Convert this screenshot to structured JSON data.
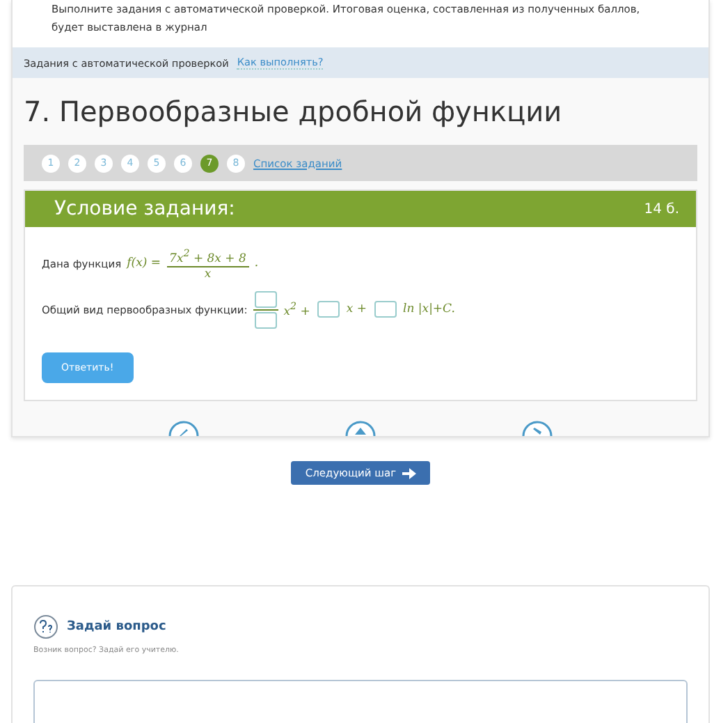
{
  "intro": {
    "text": "Выполните задания с автоматической проверкой. Итоговая оценка, составленная из полученных баллов, будет выставлена в журнал"
  },
  "section_bar": {
    "label": "Задания с автоматической проверкой",
    "link": "Как выполнять?"
  },
  "title": "7. Первообразные дробной функции",
  "pagination": {
    "pages": [
      {
        "label": "1",
        "selected": false
      },
      {
        "label": "2",
        "selected": false
      },
      {
        "label": "3",
        "selected": false
      },
      {
        "label": "4",
        "selected": false
      },
      {
        "label": "5",
        "selected": false
      },
      {
        "label": "6",
        "selected": false
      },
      {
        "label": "7",
        "selected": true
      },
      {
        "label": "8",
        "selected": false
      }
    ],
    "list_link": "Список заданий"
  },
  "task": {
    "header": "Условие задания:",
    "points": "14 б.",
    "given_label": "Дана функция",
    "function_name": "f(x) =",
    "numerator": "7x$^{2}$ + 8x + 8",
    "denominator": "x",
    "given_end": ".",
    "answer_label": "Общий вид первообразных функции:",
    "term_1": "x$^{2}$ +",
    "term_2": "x +",
    "term_3": "ln |x|+C.",
    "submit": "Ответить!"
  },
  "next_button": "Следующий шаг",
  "question": {
    "title": "Задай вопрос",
    "subtitle": "Возник вопрос? Задай его учителю."
  }
}
